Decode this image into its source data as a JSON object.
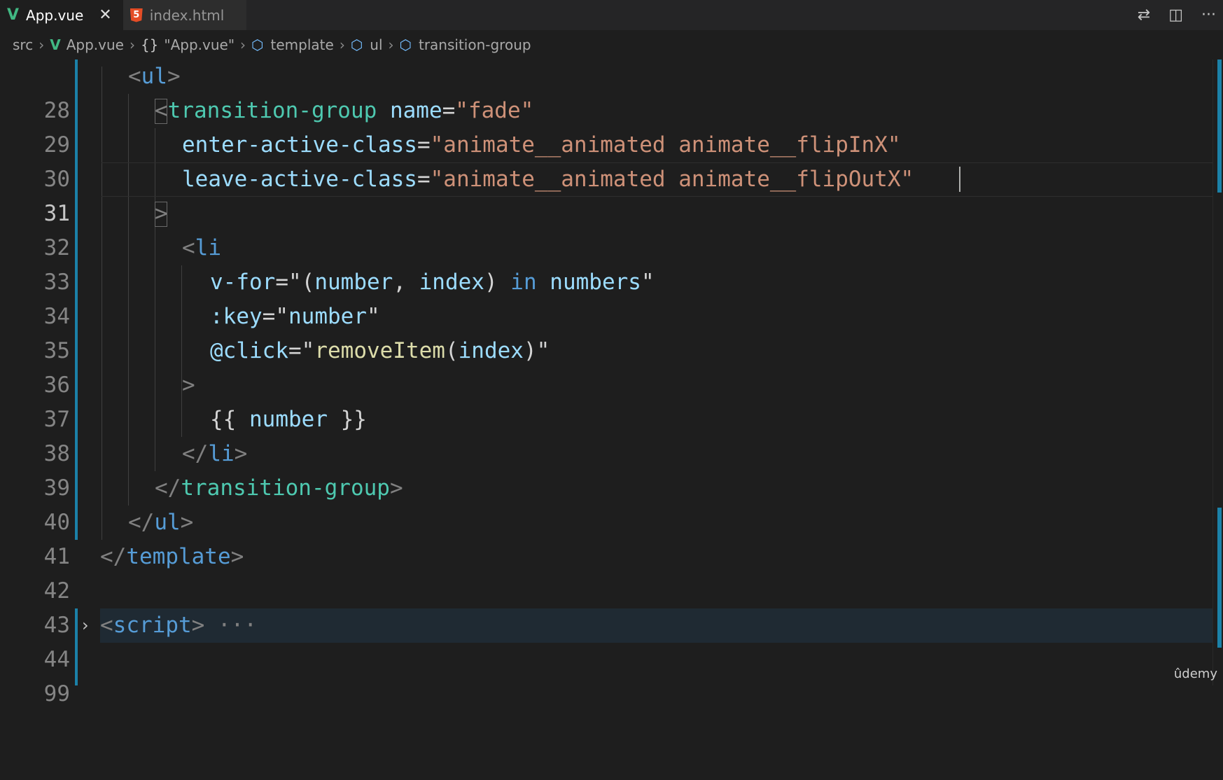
{
  "tabs": [
    {
      "label": "App.vue",
      "icon": "vue-icon",
      "active": true
    },
    {
      "label": "index.html",
      "icon": "html5-icon",
      "active": false
    }
  ],
  "tab_actions": [
    "source-control-icon",
    "split-editor-icon",
    "more-actions-icon"
  ],
  "breadcrumb": {
    "src": "src",
    "file": "App.vue",
    "symbol": "\"App.vue\"",
    "template": "template",
    "ul": "ul",
    "group": "transition-group"
  },
  "editor": {
    "current_line": 31,
    "lines": [
      {
        "num": "28"
      },
      {
        "num": "29"
      },
      {
        "num": "30"
      },
      {
        "num": "31"
      },
      {
        "num": "32"
      },
      {
        "num": "33"
      },
      {
        "num": "34"
      },
      {
        "num": "35"
      },
      {
        "num": "36"
      },
      {
        "num": "37"
      },
      {
        "num": "38"
      },
      {
        "num": "39"
      },
      {
        "num": "40"
      },
      {
        "num": "41"
      },
      {
        "num": "42"
      },
      {
        "num": "43"
      },
      {
        "num": "44"
      },
      {
        "num": "99"
      }
    ],
    "code": {
      "l28_tag": "ul",
      "l29_tag": "transition-group",
      "l29_attr": "name",
      "l29_val": "\"fade\"",
      "l30_attr": "enter-active-class",
      "l30_val": "\"animate__animated animate__flipInX\"",
      "l31_attr": "leave-active-class",
      "l31_val": "\"animate__animated animate__flipOutX\"",
      "l33_tag": "li",
      "l34_attr": "v-for",
      "l34_q1": "\"(",
      "l34_var1": "number",
      "l34_comma": ", ",
      "l34_var2": "index",
      "l34_close": ") ",
      "l34_kw": "in",
      "l34_space": " ",
      "l34_var3": "numbers",
      "l34_q2": "\"",
      "l35_attr": ":key",
      "l35_q1": "\"",
      "l35_var": "number",
      "l35_q2": "\"",
      "l36_attr": "@click",
      "l36_q1": "\"",
      "l36_fn": "removeItem",
      "l36_paren1": "(",
      "l36_var": "index",
      "l36_paren2": ")",
      "l36_q2": "\"",
      "l38_open": "{{ ",
      "l38_var": "number",
      "l38_close": " }}",
      "l39_tag": "li",
      "l40_tag": "transition-group",
      "l41_tag": "ul",
      "l42_tag": "template",
      "l44_tag": "script",
      "l44_ellipsis": "···"
    }
  },
  "watermark": "ûdemy"
}
